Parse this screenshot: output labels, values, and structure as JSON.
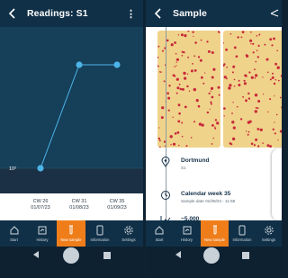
{
  "left": {
    "title": "Readings: S1",
    "menu": "⋮",
    "chart_data": {
      "type": "line",
      "categories": [
        "CW 26",
        "CW 31",
        "CW 35"
      ],
      "dates": [
        "01/07/23",
        "01/08/23",
        "01/09/23"
      ],
      "values": [
        100,
        5000,
        5000
      ],
      "ytick": "10²",
      "ylabel": "",
      "xlabel": ""
    },
    "nav": [
      "Start",
      "History",
      "New sample",
      "Information",
      "Settings"
    ]
  },
  "right": {
    "title": "Sample",
    "location": "Dortmund",
    "location_sub": "S1",
    "week": "Calendar week 35",
    "week_sub": "Sample date 01/09/23 - 11:58",
    "count": "~5,000",
    "count_sub": "TTC",
    "nav": [
      "Start",
      "History",
      "New sample",
      "Information",
      "Settings"
    ]
  },
  "colors": {
    "accent": "#ef7d1a",
    "line": "#4cb4e8",
    "dark": "#103047"
  }
}
